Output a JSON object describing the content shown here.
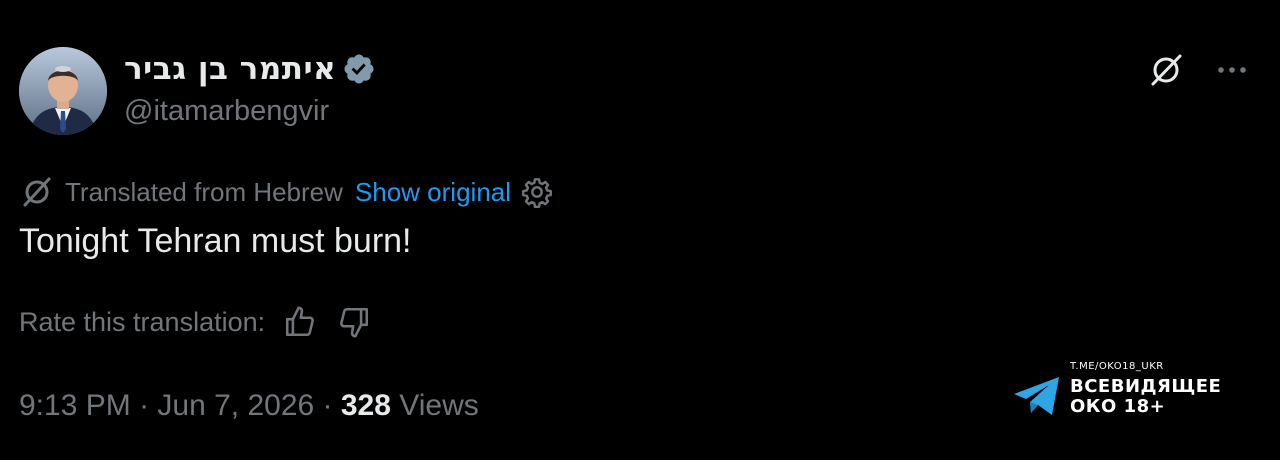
{
  "author": {
    "display_name": "איתמר בן גביר",
    "handle": "@itamarbengvir",
    "verified": true,
    "verified_color": "#829aab"
  },
  "icons": {
    "verified": "verified-badge-icon",
    "grok": "grok-icon",
    "more": "more-options-icon",
    "translate": "translate-icon",
    "settings": "gear-icon",
    "thumbs_up": "thumbs-up-icon",
    "thumbs_down": "thumbs-down-icon",
    "watermark_logo": "telegram-icon"
  },
  "translation": {
    "label": "Translated from Hebrew",
    "show_original": "Show original"
  },
  "tweet": {
    "text": "Tonight Tehran must burn!"
  },
  "rating": {
    "label": "Rate this translation:"
  },
  "meta": {
    "time": "9:13 PM",
    "separator": " · ",
    "date": "Jun 7, 2026",
    "views_count": "328",
    "views_label": "Views"
  },
  "watermark": {
    "url": "T.ME/OKO18_UKR",
    "name_line1": "ВСЕВИДЯЩЕЕ",
    "name_line2": "ОКО 18+"
  },
  "colors": {
    "background": "#000000",
    "text_primary": "#e7e9ea",
    "text_secondary": "#71767b",
    "accent": "#1d9bf0",
    "telegram_blue": "#2ea6e6"
  }
}
